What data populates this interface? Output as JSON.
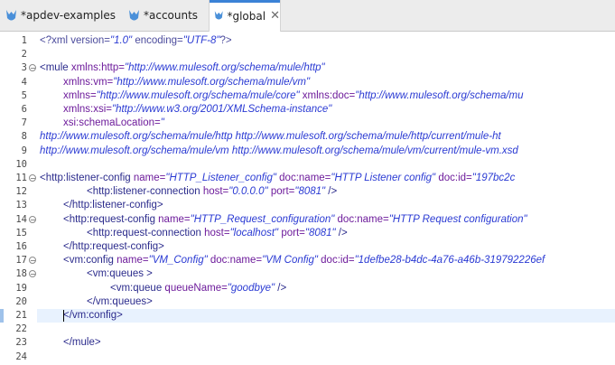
{
  "tabs": [
    {
      "label": "*apdev-examples",
      "active": false
    },
    {
      "label": "*accounts",
      "active": false
    },
    {
      "label": "*global",
      "active": true,
      "close": "✕"
    }
  ],
  "editor": {
    "current_line": 21,
    "lines": [
      {
        "n": "1",
        "segs": [
          [
            "pr",
            "<?xml version="
          ],
          [
            "st",
            "\"1.0\""
          ],
          [
            "pr",
            " encoding="
          ],
          [
            "st",
            "\"UTF-8\""
          ],
          [
            "pr",
            "?>"
          ]
        ]
      },
      {
        "n": "2",
        "segs": []
      },
      {
        "n": "3",
        "fold": "−",
        "segs": [
          [
            "tg",
            "<mule"
          ],
          [
            "at",
            " xmlns:http="
          ],
          [
            "st",
            "\"http://www.mulesoft.org/schema/mule/http\""
          ]
        ]
      },
      {
        "n": "4",
        "indent": 2,
        "segs": [
          [
            "at",
            "xmlns:vm="
          ],
          [
            "st",
            "\"http://www.mulesoft.org/schema/mule/vm\""
          ]
        ]
      },
      {
        "n": "5",
        "indent": 2,
        "segs": [
          [
            "at",
            "xmlns="
          ],
          [
            "st",
            "\"http://www.mulesoft.org/schema/mule/core\""
          ],
          [
            "at",
            " xmlns:doc="
          ],
          [
            "st",
            "\"http://www.mulesoft.org/schema/mu"
          ]
        ]
      },
      {
        "n": "6",
        "indent": 2,
        "segs": [
          [
            "at",
            "xmlns:xsi="
          ],
          [
            "st",
            "\"http://www.w3.org/2001/XMLSchema-instance\""
          ]
        ]
      },
      {
        "n": "7",
        "indent": 2,
        "segs": [
          [
            "at",
            "xsi:schemaLocation="
          ],
          [
            "st",
            "\""
          ]
        ]
      },
      {
        "n": "8",
        "indent": 0,
        "segs": [
          [
            "st",
            "http://www.mulesoft.org/schema/mule/http http://www.mulesoft.org/schema/mule/http/current/mule-ht"
          ]
        ]
      },
      {
        "n": "9",
        "indent": 0,
        "segs": [
          [
            "st",
            "http://www.mulesoft.org/schema/mule/vm http://www.mulesoft.org/schema/mule/vm/current/mule-vm.xsd"
          ]
        ]
      },
      {
        "n": "10",
        "segs": []
      },
      {
        "n": "11",
        "fold": "−",
        "indent": 0,
        "segs": [
          [
            "tg",
            "<http:listener-config"
          ],
          [
            "at",
            " name="
          ],
          [
            "st",
            "\"HTTP_Listener_config\""
          ],
          [
            "at",
            " doc:name="
          ],
          [
            "st",
            "\"HTTP Listener config\""
          ],
          [
            "at",
            " doc:id="
          ],
          [
            "st",
            "\"197bc2c"
          ]
        ]
      },
      {
        "n": "12",
        "indent": 4,
        "segs": [
          [
            "tg",
            "<http:listener-connection"
          ],
          [
            "at",
            " host="
          ],
          [
            "st",
            "\"0.0.0.0\""
          ],
          [
            "at",
            " port="
          ],
          [
            "st",
            "\"8081\""
          ],
          [
            "tg",
            " />"
          ]
        ]
      },
      {
        "n": "13",
        "indent": 2,
        "segs": [
          [
            "tg",
            "</http:listener-config>"
          ]
        ]
      },
      {
        "n": "14",
        "fold": "−",
        "indent": 2,
        "segs": [
          [
            "tg",
            "<http:request-config"
          ],
          [
            "at",
            " name="
          ],
          [
            "st",
            "\"HTTP_Request_configuration\""
          ],
          [
            "at",
            " doc:name="
          ],
          [
            "st",
            "\"HTTP Request configuration\""
          ]
        ]
      },
      {
        "n": "15",
        "indent": 4,
        "segs": [
          [
            "tg",
            "<http:request-connection"
          ],
          [
            "at",
            " host="
          ],
          [
            "st",
            "\"localhost\""
          ],
          [
            "at",
            " port="
          ],
          [
            "st",
            "\"8081\""
          ],
          [
            "tg",
            " />"
          ]
        ]
      },
      {
        "n": "16",
        "indent": 2,
        "segs": [
          [
            "tg",
            "</http:request-config>"
          ]
        ]
      },
      {
        "n": "17",
        "fold": "−",
        "indent": 2,
        "segs": [
          [
            "tg",
            "<vm:config"
          ],
          [
            "at",
            " name="
          ],
          [
            "st",
            "\"VM_Config\""
          ],
          [
            "at",
            " doc:name="
          ],
          [
            "st",
            "\"VM Config\""
          ],
          [
            "at",
            " doc:id="
          ],
          [
            "st",
            "\"1defbe28-b4dc-4a76-a46b-319792226ef"
          ]
        ]
      },
      {
        "n": "18",
        "fold": "−",
        "indent": 4,
        "segs": [
          [
            "tg",
            "<vm:queues >"
          ]
        ]
      },
      {
        "n": "19",
        "indent": 6,
        "segs": [
          [
            "tg",
            "<vm:queue"
          ],
          [
            "at",
            " queueName="
          ],
          [
            "st",
            "\"goodbye\""
          ],
          [
            "tg",
            " />"
          ]
        ]
      },
      {
        "n": "20",
        "indent": 4,
        "segs": [
          [
            "tg",
            "</vm:queues>"
          ]
        ]
      },
      {
        "n": "21",
        "indent": 2,
        "segs": [
          [
            "tg",
            "</vm:config>"
          ]
        ]
      },
      {
        "n": "22",
        "segs": []
      },
      {
        "n": "23",
        "indent": 2,
        "segs": [
          [
            "tg",
            "</mule>"
          ]
        ]
      },
      {
        "n": "24",
        "segs": []
      }
    ]
  }
}
